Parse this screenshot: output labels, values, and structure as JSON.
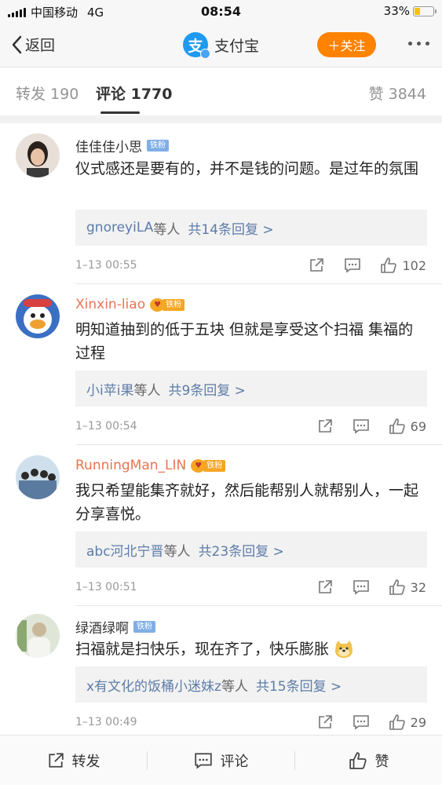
{
  "status_bar": {
    "carrier": "中国移动",
    "network": "4G",
    "time": "08:54",
    "battery": "33%",
    "battery_level": 0.33
  },
  "nav": {
    "back_label": "返回",
    "title": "支付宝",
    "logo_char": "支",
    "follow_label": "＋关注"
  },
  "tabs": [
    {
      "label": "转发 190",
      "active": false
    },
    {
      "label": "评论 1770",
      "active": true
    },
    {
      "label": "赞 3844",
      "active": false
    }
  ],
  "comments": [
    {
      "username": "佳佳佳小思",
      "name_color": "gray",
      "badge": "铁粉",
      "badge_style": "plain",
      "text": "仪式感还是要有的，并不是钱的问题。是过年的氛围",
      "reply_who": "gnoreyiLA",
      "reply_suffix": "等人",
      "reply_total": "共14条回复 >",
      "time": "1–13 00:55",
      "likes": "102"
    },
    {
      "username": "Xinxin-liao",
      "name_color": "orange",
      "badge": "铁粉",
      "badge_style": "orange",
      "text": "明知道抽到的低于五块 但就是享受这个扫福 集福的过程",
      "reply_who": "小i苹i果",
      "reply_suffix": "等人",
      "reply_total": "共9条回复 >",
      "time": "1–13 00:54",
      "likes": "69"
    },
    {
      "username": "RunningMan_LIN",
      "name_color": "orange",
      "badge": "铁粉",
      "badge_style": "orange",
      "text": "我只希望能集齐就好，然后能帮别人就帮别人，一起分享喜悦。",
      "reply_who": "abc河北宁晋",
      "reply_suffix": "等人",
      "reply_total": "共23条回复 >",
      "time": "1–13 00:51",
      "likes": "32"
    },
    {
      "username": "绿酒绿啊",
      "name_color": "gray",
      "badge": "铁粉",
      "badge_style": "plain",
      "text": "扫福就是扫快乐，现在齐了，快乐膨胀",
      "reply_who": "x有文化的饭桶小迷妹z",
      "reply_suffix": "等人",
      "reply_total": "共15条回复 >",
      "time": "1–13 00:49",
      "likes": "29"
    }
  ],
  "bottom_bar": {
    "repost": "转发",
    "comment": "评论",
    "like": "赞"
  },
  "colors": {
    "accent": "#ff8200",
    "link": "#5d7ca8",
    "orange_name": "#eb7350",
    "alipay_blue": "#1e9bf0"
  },
  "icons": [
    "back-chevron-icon",
    "alipay-logo-icon",
    "more-dots-icon",
    "share-icon",
    "comment-icon",
    "thumb-up-icon",
    "fan-heart-icon",
    "doge-emoji-icon"
  ]
}
